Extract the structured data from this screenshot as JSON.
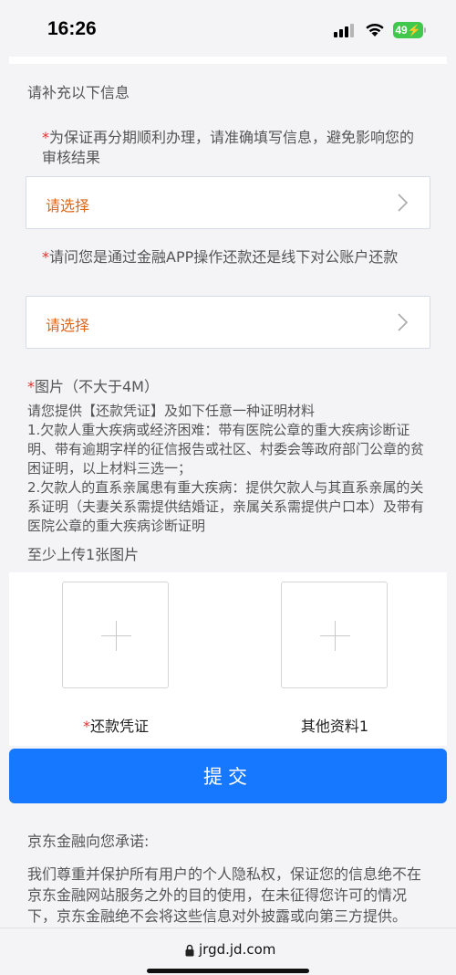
{
  "status_bar": {
    "time": "16:26",
    "battery": "49"
  },
  "form": {
    "section_title": "请补充以下信息",
    "question1": {
      "required_mark": "*",
      "label": "为保证再分期顺利办理，请准确填写信息，避免影响您的审核结果",
      "select_placeholder": "请选择"
    },
    "question2": {
      "required_mark": "*",
      "label": "请问您是通过金融APP操作还款还是线下对公账户还款",
      "select_placeholder": "请选择"
    },
    "images": {
      "required_mark": "*",
      "title": "图片（不大于4M）",
      "description": [
        "请您提供【还款凭证】及如下任意一种证明材料",
        "1.欠款人重大疾病或经济困难：带有医院公章的重大疾病诊断证明、带有逾期字样的征信报告或社区、村委会等政府部门公章的贫困证明，以上材料三选一；",
        "2.欠款人的直系亲属患有重大疾病：提供欠款人与其直系亲属的关系证明（夫妻关系需提供结婚证，亲属关系需提供户口本）及带有医院公章的重大疾病诊断证明"
      ],
      "min_upload": "至少上传1张图片",
      "slots": [
        {
          "required_mark": "*",
          "label": "还款凭证"
        },
        {
          "required_mark": "",
          "label": "其他资料1"
        }
      ]
    },
    "submit_label": "提交"
  },
  "promise": {
    "title": "京东金融向您承诺:",
    "body": "我们尊重并保护所有用户的个人隐私权，保证您的信息绝不在京东金融网站服务之外的目的使用，在未征得您许可的情况下，京东金融绝不会将这些信息对外披露或向第三方提供。"
  },
  "browser": {
    "url": "jrgd.jd.com"
  },
  "colors": {
    "accent": "#1677ff",
    "placeholder": "#e0661a",
    "required": "#e0332e",
    "battery": "#3fc84c"
  },
  "icons": {
    "select_arrow": "chevron-right-icon",
    "upload": "plus-icon",
    "url": "lock-icon",
    "signal": "cellular-signal-icon",
    "wifi": "wifi-icon"
  }
}
